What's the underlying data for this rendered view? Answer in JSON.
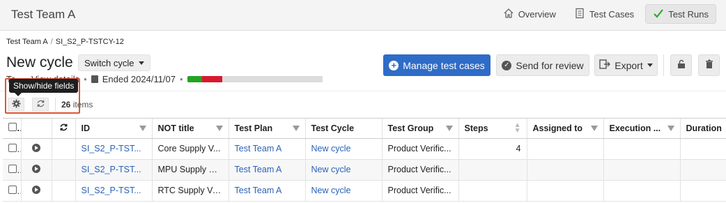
{
  "header": {
    "team_name": "Test Team A",
    "nav": [
      {
        "label": "Overview",
        "icon": "home-icon",
        "active": false
      },
      {
        "label": "Test Cases",
        "icon": "document-icon",
        "active": false
      },
      {
        "label": "Test Runs",
        "icon": "checkmark-icon",
        "active": true
      }
    ]
  },
  "breadcrumb": [
    "Test Team A",
    "SI_S2_P-TSTCY-12"
  ],
  "cycle": {
    "title": "New cycle",
    "switch_label": "Switch cycle",
    "view_details_partial": "Te",
    "view_details_label": "View details",
    "ended_label": "Ended 2024/11/07",
    "progress": [
      {
        "status": "passed",
        "fraction": 0.11,
        "color": "#23a323"
      },
      {
        "status": "failed",
        "fraction": 0.15,
        "color": "#d9182e"
      },
      {
        "status": "not run",
        "fraction": 0.74,
        "color": "#dcdcdc"
      }
    ]
  },
  "actions": {
    "manage": "Manage test cases",
    "review": "Send for review",
    "export": "Export"
  },
  "toolbar": {
    "tooltip": "Show/hide fields",
    "count_number": "26",
    "count_label": "items"
  },
  "table": {
    "columns": [
      "",
      "",
      "",
      "ID",
      "NOT title",
      "Test Plan",
      "Test Cycle",
      "Test Group",
      "Steps",
      "Assigned to",
      "Execution ...",
      "Duration"
    ],
    "rows": [
      {
        "id": "SI_S2_P-TST...",
        "title": "Core Supply V...",
        "plan": "Test Team A",
        "cycle": "New cycle",
        "group": "Product Verific...",
        "steps": "4",
        "assigned": "",
        "execution": "",
        "duration": ""
      },
      {
        "id": "SI_S2_P-TST...",
        "title": "MPU Supply Vo...",
        "plan": "Test Team A",
        "cycle": "New cycle",
        "group": "Product Verific...",
        "steps": "",
        "assigned": "",
        "execution": "",
        "duration": ""
      },
      {
        "id": "SI_S2_P-TST...",
        "title": "RTC Supply Vo...",
        "plan": "Test Team A",
        "cycle": "New cycle",
        "group": "Product Verific...",
        "steps": "",
        "assigned": "",
        "execution": "",
        "duration": ""
      }
    ]
  }
}
